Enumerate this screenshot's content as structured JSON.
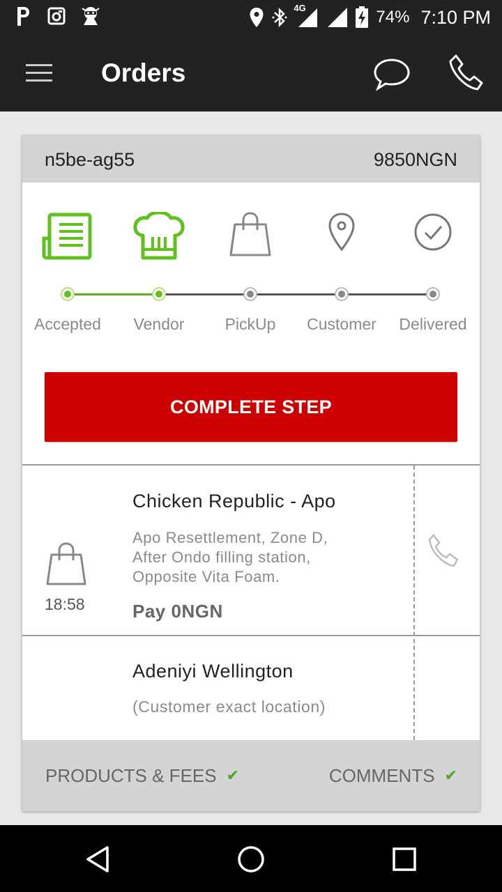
{
  "status_bar": {
    "network": "4G",
    "battery": "74%",
    "time": "7:10 PM"
  },
  "app_bar": {
    "title": "Orders"
  },
  "order": {
    "id": "n5be-ag55",
    "total": "9850NGN"
  },
  "steps": [
    {
      "label": "Accepted",
      "icon": "order-list-icon",
      "done": true
    },
    {
      "label": "Vendor",
      "icon": "chef-hat-icon",
      "done": true
    },
    {
      "label": "PickUp",
      "icon": "shopping-bag-icon",
      "done": false
    },
    {
      "label": "Customer",
      "icon": "location-pin-icon",
      "done": false
    },
    {
      "label": "Delivered",
      "icon": "check-circle-icon",
      "done": false
    }
  ],
  "complete_step_label": "COMPLETE STEP",
  "vendor": {
    "time": "18:58",
    "name": "Chicken Republic - Apo",
    "address_lines": [
      "Apo Resettlement, Zone D,",
      "After Ondo filling station,",
      "Opposite Vita Foam."
    ],
    "pay": "Pay 0NGN"
  },
  "customer": {
    "name": "Adeniyi Wellington",
    "location": "(Customer exact location)"
  },
  "footer": {
    "products_label": "PRODUCTS & FEES",
    "comments_label": "COMMENTS",
    "check": "✔"
  },
  "colors": {
    "accent_green": "#5fc01e",
    "button_red": "#cc0000",
    "app_bar": "#222222"
  }
}
